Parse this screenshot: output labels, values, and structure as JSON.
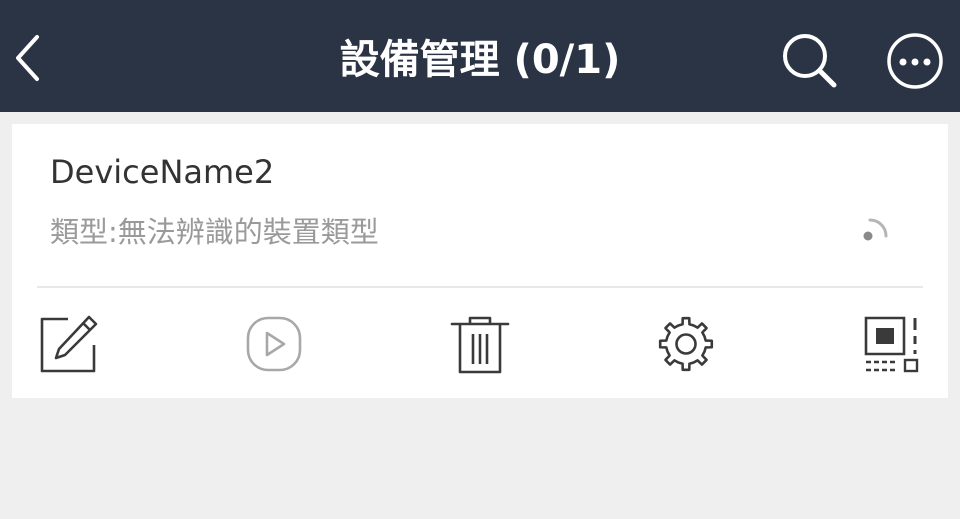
{
  "header": {
    "title": "設備管理 (0/1)",
    "back_icon": "chevron-left-icon",
    "search_icon": "search-icon",
    "more_icon": "more-horizontal-icon"
  },
  "device": {
    "name": "DeviceName2",
    "type_text": "類型:無法辨識的裝置類型",
    "status_icon": "signal-icon"
  },
  "actions": [
    {
      "icon": "edit-icon"
    },
    {
      "icon": "play-icon"
    },
    {
      "icon": "trash-icon"
    },
    {
      "icon": "gear-icon"
    },
    {
      "icon": "qr-code-icon"
    }
  ],
  "colors": {
    "header_bg": "#2b3445",
    "card_bg": "#ffffff",
    "page_bg": "#efefef",
    "icon_dark": "#3a3a3a",
    "icon_disabled": "#a8a8a8"
  }
}
